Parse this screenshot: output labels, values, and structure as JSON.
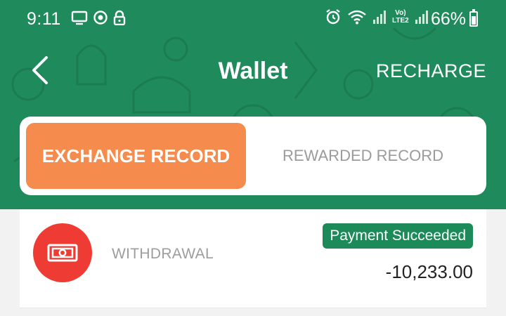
{
  "status_bar": {
    "time": "9:11",
    "battery_percent": "66%",
    "left_icons": [
      "screen-cast-icon",
      "sync-icon",
      "lock-icon"
    ],
    "right_icons": [
      "alarm-icon",
      "wifi-icon",
      "signal-icon",
      "volte-lte2-icon",
      "signal-icon-2"
    ],
    "volte_label_top": "Vo)",
    "volte_label_bottom": "LTE2",
    "battery_level": 0.66
  },
  "nav": {
    "title": "Wallet",
    "back_icon": "chevron-left-icon",
    "action_label": "RECHARGE"
  },
  "tabs": [
    {
      "label": "EXCHANGE RECORD",
      "active": true
    },
    {
      "label": "REWARDED RECORD",
      "active": false
    }
  ],
  "records": [
    {
      "icon": "money-bill-icon",
      "label": "WITHDRAWAL",
      "status": "Payment Succeeded",
      "amount": "-10,233.00"
    }
  ],
  "colors": {
    "header_green": "#1f8a5b",
    "active_tab_orange": "#f58b4c",
    "withdrawal_icon_red": "#ee3b33",
    "status_badge_green": "#1d8a5a"
  }
}
